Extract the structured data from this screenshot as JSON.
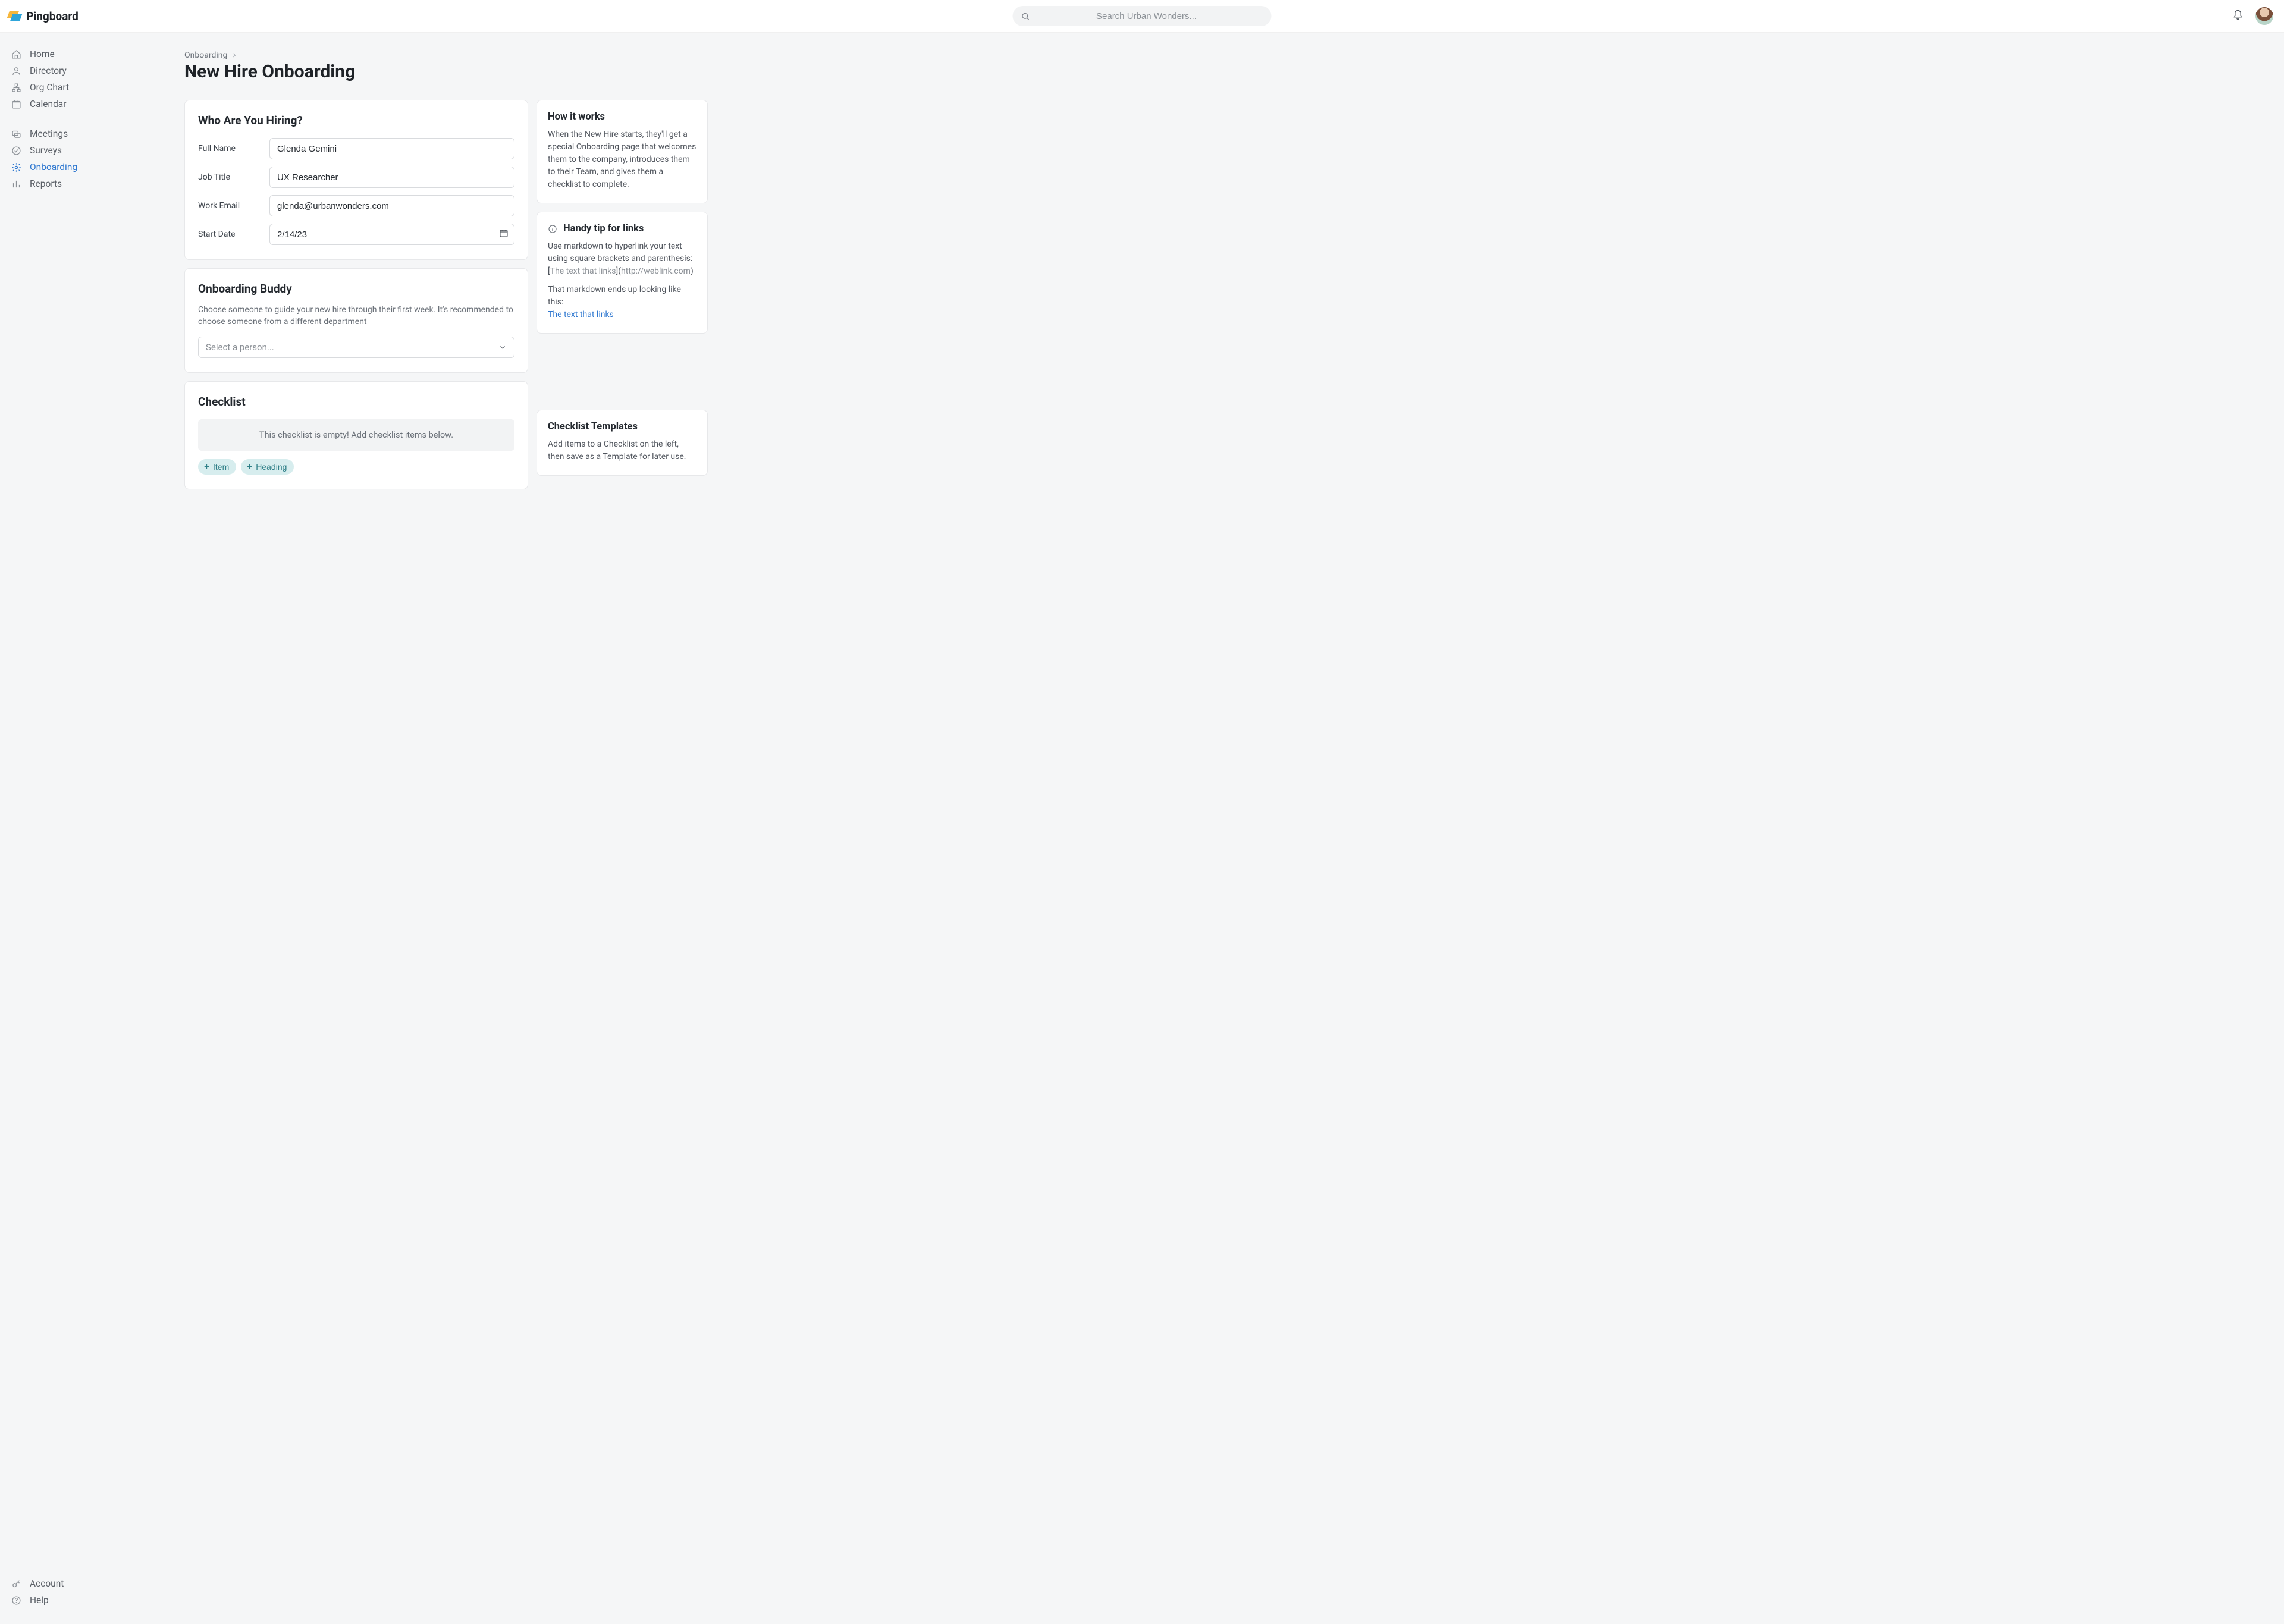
{
  "brand": "Pingboard",
  "search": {
    "placeholder": "Search Urban Wonders..."
  },
  "sidebar": {
    "group1": [
      {
        "label": "Home"
      },
      {
        "label": "Directory"
      },
      {
        "label": "Org Chart"
      },
      {
        "label": "Calendar"
      }
    ],
    "group2": [
      {
        "label": "Meetings"
      },
      {
        "label": "Surveys"
      },
      {
        "label": "Onboarding"
      },
      {
        "label": "Reports"
      }
    ],
    "bottom": [
      {
        "label": "Account"
      },
      {
        "label": "Help"
      }
    ]
  },
  "breadcrumb": {
    "root": "Onboarding"
  },
  "page_title": "New Hire Onboarding",
  "hiring": {
    "section_title": "Who Are You Hiring?",
    "full_name_label": "Full Name",
    "full_name_value": "Glenda Gemini",
    "job_title_label": "Job Title",
    "job_title_value": "UX Researcher",
    "work_email_label": "Work Email",
    "work_email_value": "glenda@urbanwonders.com",
    "start_date_label": "Start Date",
    "start_date_value": "2/14/23"
  },
  "buddy": {
    "section_title": "Onboarding Buddy",
    "help": "Choose someone to guide your new hire through their first week. It's recommended to choose someone from a different department",
    "select_placeholder": "Select a person..."
  },
  "checklist": {
    "section_title": "Checklist",
    "empty_message": "This checklist is empty! Add checklist items below.",
    "item_label": "Item",
    "heading_label": "Heading"
  },
  "how_it_works": {
    "title": "How it works",
    "body": "When the New Hire starts, they'll get a special Onboarding page that welcomes them to the company, introduces them to their Team, and gives them a checklist to complete."
  },
  "tip": {
    "title": "Handy tip for links",
    "line1": "Use markdown to hyperlink your text using square brackets and parenthesis:",
    "example_open": "[",
    "example_text": "The text that links",
    "example_mid": "](",
    "example_url": "http://weblink.com",
    "example_close": ")",
    "line2": "That markdown ends up looking like this:",
    "link_text": "The text that links"
  },
  "templates": {
    "title": "Checklist Templates",
    "body": "Add items to a Checklist on the left, then save as a Template for later use."
  }
}
